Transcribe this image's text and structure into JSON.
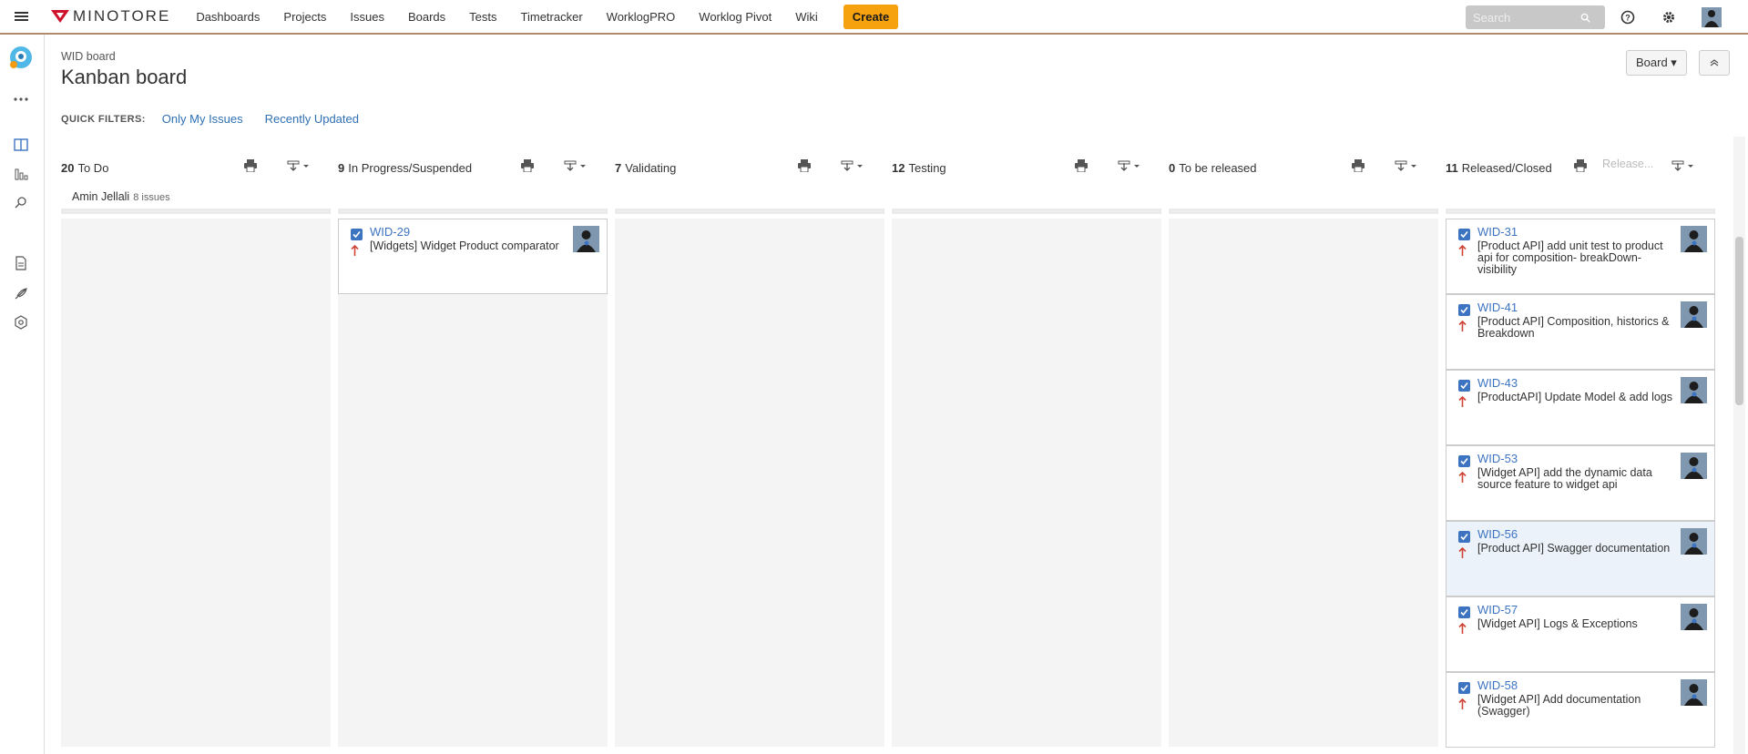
{
  "topbar": {
    "logo_text": "MINOTORE",
    "nav": [
      "Dashboards",
      "Projects",
      "Issues",
      "Boards",
      "Tests",
      "Timetracker",
      "WorklogPRO",
      "Worklog Pivot",
      "Wiki"
    ],
    "create_label": "Create",
    "search_placeholder": "Search"
  },
  "header": {
    "breadcrumb": "WID board",
    "title": "Kanban board",
    "board_button": "Board ▾"
  },
  "quick_filters": {
    "label": "QUICK FILTERS:",
    "items": [
      "Only My Issues",
      "Recently Updated"
    ]
  },
  "columns": [
    {
      "count": "20",
      "name": "To Do"
    },
    {
      "count": "9",
      "name": "In Progress/Suspended"
    },
    {
      "count": "7",
      "name": "Validating"
    },
    {
      "count": "12",
      "name": "Testing"
    },
    {
      "count": "0",
      "name": "To be released"
    },
    {
      "count": "11",
      "name": "Released/Closed",
      "release_label": "Release..."
    }
  ],
  "swimlane": {
    "name": "Amin Jellali",
    "count": "8 issues"
  },
  "cards": {
    "inprogress": [
      {
        "key": "WID-29",
        "summary": "[Widgets] Widget Product comparator"
      }
    ],
    "released": [
      {
        "key": "WID-31",
        "summary": "[Product API] add unit test to product api for composition- breakDown- visibility"
      },
      {
        "key": "WID-41",
        "summary": "[Product API] Composition, historics & Breakdown"
      },
      {
        "key": "WID-43",
        "summary": "[ProductAPI] Update Model & add logs"
      },
      {
        "key": "WID-53",
        "summary": "[Widget API] add the dynamic data source feature to widget api"
      },
      {
        "key": "WID-56",
        "summary": "[Product API] Swagger documentation"
      },
      {
        "key": "WID-57",
        "summary": "[Widget API] Logs & Exceptions"
      },
      {
        "key": "WID-58",
        "summary": "[Widget API] Add documentation (Swagger)"
      }
    ]
  },
  "colors": {
    "brand_red": "#d0112b",
    "link": "#2f6fb3",
    "create": "#f6a20f",
    "priority": "#d04437"
  },
  "icons": [
    "menu-icon",
    "help-icon",
    "gear-icon",
    "user-avatar",
    "board-icon",
    "reports-icon",
    "search-issues-icon",
    "pages-icon",
    "feather-icon",
    "settings-icon",
    "printer-icon",
    "export-icon",
    "priority-high-icon"
  ]
}
